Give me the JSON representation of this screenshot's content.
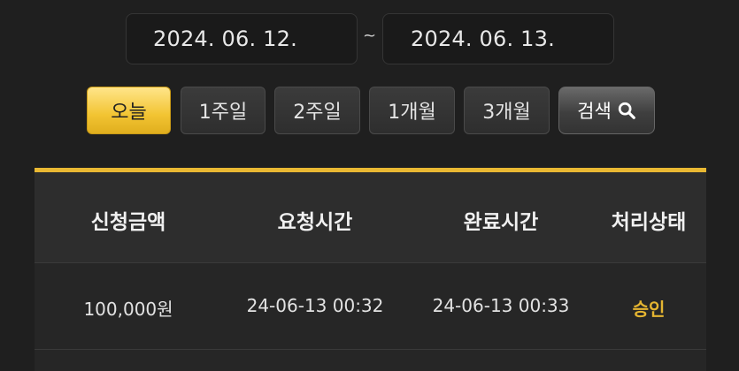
{
  "date_range": {
    "from": "2024. 06. 12.",
    "separator": "~",
    "to": "2024. 06. 13."
  },
  "period_buttons": [
    {
      "label": "오늘",
      "active": true
    },
    {
      "label": "1주일",
      "active": false
    },
    {
      "label": "2주일",
      "active": false
    },
    {
      "label": "1개월",
      "active": false
    },
    {
      "label": "3개월",
      "active": false
    }
  ],
  "search": {
    "label": "검색",
    "icon": "search-icon"
  },
  "colors": {
    "accent": "#e9b833",
    "status_approved": "#e5b531"
  },
  "table": {
    "headers": [
      "신청금액",
      "요청시간",
      "완료시간",
      "처리상태"
    ],
    "rows": [
      {
        "amount": "100,000원",
        "requested": "24-06-13 00:32",
        "completed": "24-06-13 00:33",
        "status": "승인"
      }
    ]
  }
}
